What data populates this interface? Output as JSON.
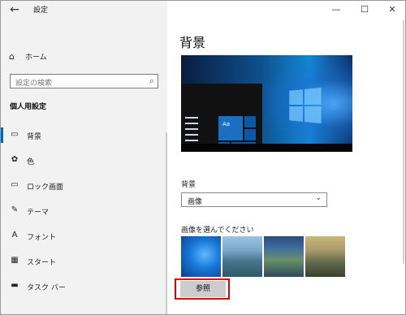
{
  "window": {
    "title": "設定",
    "back_icon": "←",
    "minimize_icon": "—",
    "maximize_icon": "☐",
    "close_icon": "✕"
  },
  "sidebar": {
    "home": {
      "label": "ホーム",
      "icon": "home-icon",
      "glyph": "⌂"
    },
    "search": {
      "placeholder": "設定の検索",
      "icon": "search-icon",
      "glyph": "⌕"
    },
    "section_title": "個人用設定",
    "items": [
      {
        "label": "背景",
        "icon": "picture-icon",
        "glyph": "▭",
        "active": true
      },
      {
        "label": "色",
        "icon": "palette-icon",
        "glyph": "✿",
        "active": false
      },
      {
        "label": "ロック画面",
        "icon": "lock-screen-icon",
        "glyph": "▭",
        "active": false
      },
      {
        "label": "テーマ",
        "icon": "theme-icon",
        "glyph": "✎",
        "active": false
      },
      {
        "label": "フォント",
        "icon": "font-icon",
        "glyph": "A",
        "active": false
      },
      {
        "label": "スタート",
        "icon": "start-icon",
        "glyph": "▦",
        "active": false
      },
      {
        "label": "タスク バー",
        "icon": "taskbar-icon",
        "glyph": "▬",
        "active": false
      }
    ],
    "accent_color": "#0067c0"
  },
  "main": {
    "title": "背景",
    "preview": {
      "tile_text": "Aa"
    },
    "background_label": "背景",
    "background_select": {
      "value": "画像",
      "icon": "chevron-down-icon",
      "glyph": "⌄"
    },
    "choose_label": "画像を選んでください",
    "thumbnails": [
      "windows-blue",
      "coast-rocks",
      "lake-mountains",
      "golden-hills"
    ],
    "browse_button": "参照",
    "highlight_color": "#e00000"
  }
}
